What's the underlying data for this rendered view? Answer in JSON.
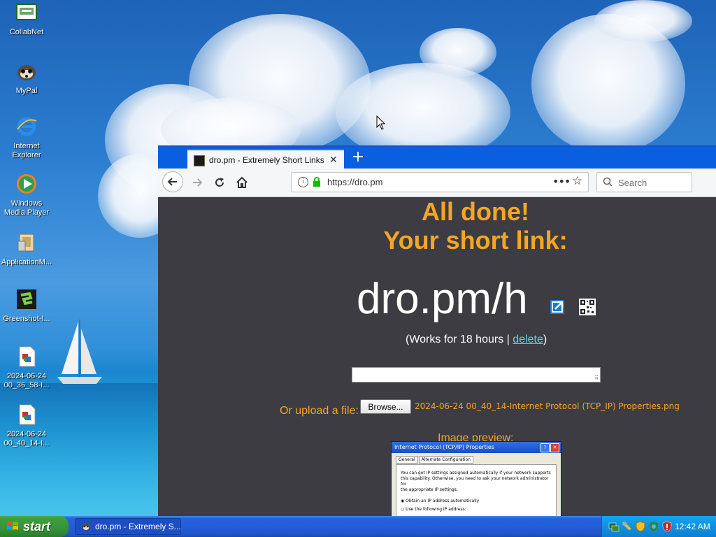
{
  "desktop": {
    "icons": [
      {
        "label": "CollabNet",
        "icon": "collabnet-icon"
      },
      {
        "label": "MyPal",
        "icon": "mypal-icon"
      },
      {
        "label": "Internet Explorer",
        "icon": "internet-explorer-icon"
      },
      {
        "label": "Windows Media Player",
        "icon": "windows-media-player-icon"
      },
      {
        "label": "ApplicationM...",
        "icon": "application-icon"
      },
      {
        "label": "Greenshot-I...",
        "icon": "greenshot-icon"
      },
      {
        "label": "2024-06-24 00_36_58-I...",
        "icon": "image-file-icon"
      },
      {
        "label": "2024-06-24 00_40_14-I...",
        "icon": "image-file-icon"
      }
    ]
  },
  "browser": {
    "tab_title": "dro.pm - Extremely Short Links",
    "tab_close": "✕",
    "new_tab": "+",
    "url": "https://dro.pm",
    "page_actions": "•••",
    "search_placeholder": "Search"
  },
  "page": {
    "headline1": "All done!",
    "headline2": "Your short link:",
    "short_link": "dro.pm/h",
    "works_prefix": "(Works for 18 hours | ",
    "delete_link": "delete",
    "works_suffix": ")",
    "upload_label": "Or upload a file:",
    "browse_button": "Browse...",
    "file_name": "2024-06-24 00_40_14-Internet Protocol (TCP_IP) Properties.png",
    "preview_label": "Image preview:",
    "accent_color": "#f5a623",
    "background_color": "#3c3c42"
  },
  "preview_image": {
    "title": "Internet Protocol (TCP/IP) Properties",
    "help_btn": "?",
    "close_btn": "✕",
    "tabs": [
      "General",
      "Alternate Configuration"
    ],
    "body_line1": "You can get IP settings assigned automatically if your network supports",
    "body_line2": "this capability. Otherwise, you need to ask your network administrator for",
    "body_line3": "the appropriate IP settings.",
    "opt1": "Obtain an IP address automatically",
    "opt2": "Use the following IP address:"
  },
  "taskbar": {
    "start_label": "start",
    "task_label": "dro.pm - Extremely S...",
    "clock": "12:42 AM"
  }
}
